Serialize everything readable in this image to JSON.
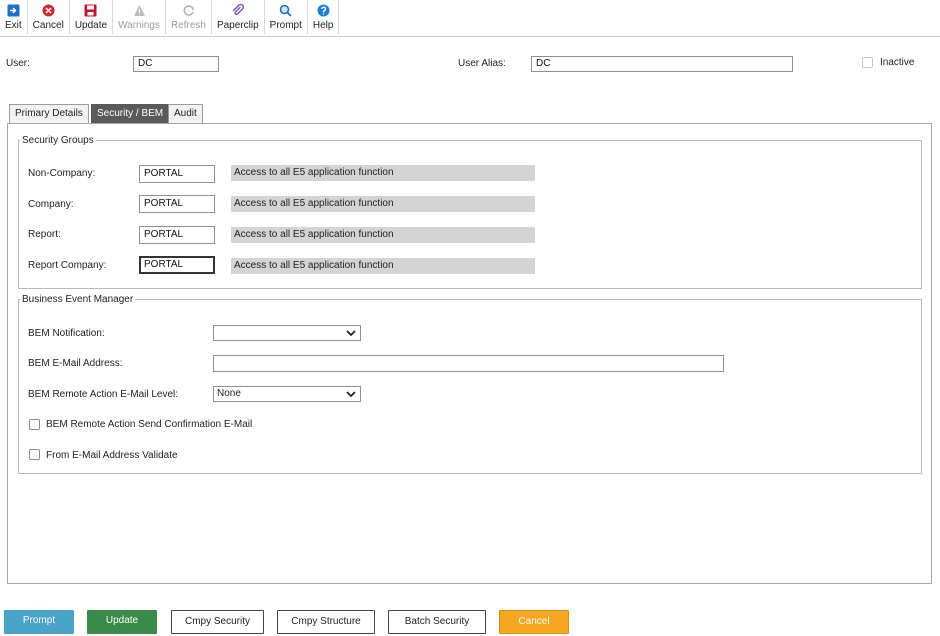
{
  "toolbar": {
    "exit": "Exit",
    "cancel": "Cancel",
    "update": "Update",
    "warnings": "Warnings",
    "refresh": "Refresh",
    "paperclip": "Paperclip",
    "prompt": "Prompt",
    "help": "Help"
  },
  "header": {
    "user_label": "User:",
    "user_value": "DC",
    "alias_label": "User Alias:",
    "alias_value": "DC",
    "inactive_label": "Inactive"
  },
  "tabs": [
    "Primary Details",
    "Security / BEM",
    "Audit"
  ],
  "security_groups": {
    "legend": "Security Groups",
    "rows": [
      {
        "label": "Non-Company:",
        "value": "PORTAL",
        "desc": "Access to all E5 application function"
      },
      {
        "label": "Company:",
        "value": "PORTAL",
        "desc": "Access to all E5 application function"
      },
      {
        "label": "Report:",
        "value": "PORTAL",
        "desc": "Access to all E5 application function"
      },
      {
        "label": "Report Company:",
        "value": "PORTAL",
        "desc": "Access to all E5 application function"
      }
    ]
  },
  "bem": {
    "legend": "Business Event Manager",
    "notification_label": "BEM Notification:",
    "notification_value": "",
    "email_label": "BEM E-Mail Address:",
    "email_value": "",
    "remote_level_label": "BEM Remote Action E-Mail Level:",
    "remote_level_value": "None",
    "send_confirmation_label": "BEM Remote Action Send Confirmation E-Mail",
    "from_validate_label": "From E-Mail Address Validate"
  },
  "buttons": {
    "prompt": "Prompt",
    "update": "Update",
    "cmpy_security": "Cmpy Security",
    "cmpy_structure": "Cmpy Structure",
    "batch_security": "Batch Security",
    "cancel": "Cancel"
  },
  "colors": {
    "prompt_bg": "#4aa3c8",
    "update_bg": "#3a8a4a",
    "cancel_bg": "#f5a623",
    "active_tab": "#5a5a5a",
    "desc_bg": "#d4d4d4"
  }
}
